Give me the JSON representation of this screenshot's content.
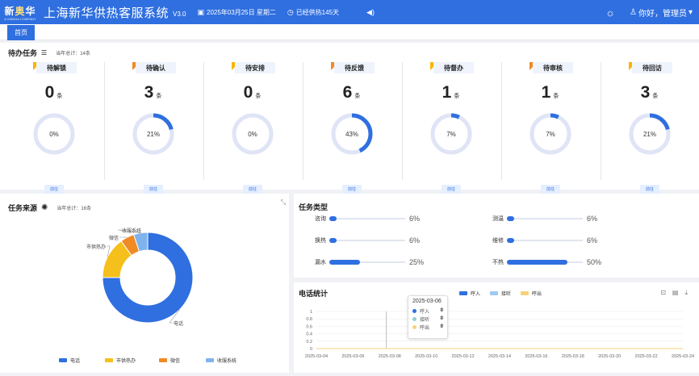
{
  "header": {
    "logo_text": "新华",
    "logo_char": "奥",
    "logo_sub": "A XINHUA COMPANY",
    "title": "上海新华供热客服系统",
    "version": "V3.0",
    "date": "2025年03月25日 星期二",
    "heating_days": "已经供热145天",
    "greeting": "你好，管理员",
    "icons": {
      "date": "calendar-icon",
      "heating": "clock-icon",
      "sound": "speaker-icon",
      "theme": "sun-icon",
      "user": "user-icon",
      "dropdown": "chevron-down-icon"
    }
  },
  "tabs": [
    {
      "label": "首页"
    }
  ],
  "pending": {
    "title": "待办任务",
    "subtitle": "当年总计：14条",
    "unit": "条",
    "button_label": "前往",
    "items": [
      {
        "label": "待解锁",
        "count": 0,
        "percent": "0%",
        "percent_value": 0,
        "flag_color": "#f7b500"
      },
      {
        "label": "待确认",
        "count": 3,
        "percent": "21%",
        "percent_value": 0.21,
        "flag_color": "#f08a24"
      },
      {
        "label": "待安排",
        "count": 0,
        "percent": "0%",
        "percent_value": 0,
        "flag_color": "#f7b500"
      },
      {
        "label": "待反馈",
        "count": 6,
        "percent": "43%",
        "percent_value": 0.43,
        "flag_color": "#f08a24"
      },
      {
        "label": "待督办",
        "count": 1,
        "percent": "7%",
        "percent_value": 0.07,
        "flag_color": "#f7b500"
      },
      {
        "label": "待审核",
        "count": 1,
        "percent": "7%",
        "percent_value": 0.07,
        "flag_color": "#f08a24"
      },
      {
        "label": "待回访",
        "count": 3,
        "percent": "21%",
        "percent_value": 0.21,
        "flag_color": "#f7b500"
      }
    ]
  },
  "source": {
    "title": "任务来源",
    "subtitle": "当年总计：16条",
    "slices": [
      {
        "name": "电话",
        "value": 0.75,
        "color": "#2f6fe0"
      },
      {
        "name": "市供热办",
        "value": 0.15,
        "color": "#f5bf1c"
      },
      {
        "name": "微信",
        "value": 0.05,
        "color": "#f08a24"
      },
      {
        "name": "收服系统",
        "value": 0.05,
        "color": "#7fb3ee"
      }
    ],
    "callouts": [
      "电话",
      "市供热办",
      "微信",
      "收服系统"
    ]
  },
  "task_type": {
    "title": "任务类型",
    "items": [
      {
        "label": "咨询",
        "percent": "6%",
        "value": 0.06
      },
      {
        "label": "测温",
        "percent": "6%",
        "value": 0.06
      },
      {
        "label": "换热",
        "percent": "6%",
        "value": 0.06
      },
      {
        "label": "维修",
        "percent": "6%",
        "value": 0.06
      },
      {
        "label": "漏水",
        "percent": "25%",
        "value": 0.25
      },
      {
        "label": "不热",
        "percent": "50%",
        "value": 0.5
      }
    ]
  },
  "calls": {
    "title": "电话统计",
    "legend": [
      {
        "name": "呼入",
        "color": "#2f6fe0"
      },
      {
        "name": "接听",
        "color": "#9ec9f5"
      },
      {
        "name": "呼出",
        "color": "#f7d27a"
      }
    ],
    "toolbar_icons": [
      "chart-type-icon",
      "data-view-icon",
      "download-icon"
    ],
    "tooltip": {
      "date": "2025-03-06",
      "rows": [
        {
          "name": "呼入",
          "value": "0",
          "color": "#2f6fe0"
        },
        {
          "name": "接听",
          "value": "0",
          "color": "#8fcfd0"
        },
        {
          "name": "呼出",
          "value": "0",
          "color": "#f7d27a"
        }
      ]
    }
  },
  "chart_data": {
    "type": "line",
    "title": "电话统计",
    "x": [
      "2025-03-04",
      "2025-03-06",
      "2025-03-08",
      "2025-03-10",
      "2025-03-12",
      "2025-03-14",
      "2025-03-16",
      "2025-03-18",
      "2025-03-20",
      "2025-03-22",
      "2025-03-24"
    ],
    "y_ticks": [
      "0",
      "0.2",
      "0.4",
      "0.6",
      "0.8",
      "1"
    ],
    "ylim": [
      0,
      1
    ],
    "series": [
      {
        "name": "呼入",
        "values": [
          0,
          0,
          0,
          0,
          0,
          0,
          0,
          0,
          0,
          0,
          0
        ]
      },
      {
        "name": "接听",
        "values": [
          0,
          0,
          0,
          0,
          0,
          0,
          0,
          0,
          0,
          0,
          0
        ]
      },
      {
        "name": "呼出",
        "values": [
          0,
          0,
          0,
          0,
          0,
          0,
          0,
          0,
          0,
          0,
          0
        ]
      }
    ],
    "legend_position": "top-center",
    "grid": true
  }
}
